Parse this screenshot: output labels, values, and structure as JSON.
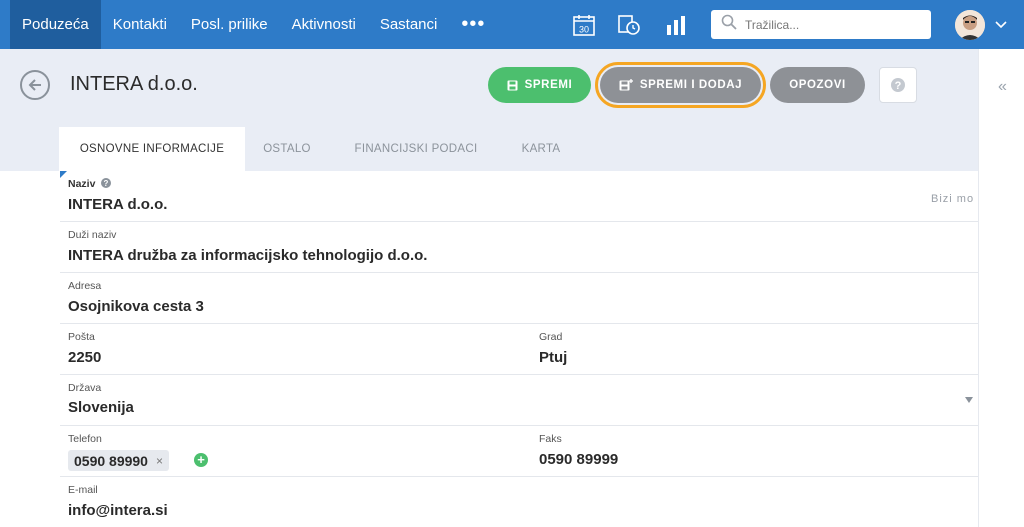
{
  "nav": {
    "items": [
      {
        "label": "Poduzeća",
        "active": true
      },
      {
        "label": "Kontakti",
        "active": false
      },
      {
        "label": "Posl. prilike",
        "active": false
      },
      {
        "label": "Aktivnosti",
        "active": false
      },
      {
        "label": "Sastanci",
        "active": false
      }
    ],
    "more_label": "•••",
    "calendar_day": "30",
    "search_placeholder": "Tražilica..."
  },
  "header": {
    "title": "INTERA d.o.o.",
    "save_label": "SPREMI",
    "save_add_label": "SPREMI I DODAJ",
    "cancel_label": "OPOZOVI",
    "help_label": "?"
  },
  "tabs": [
    {
      "label": "OSNOVNE INFORMACIJE",
      "active": true
    },
    {
      "label": "OSTALO",
      "active": false
    },
    {
      "label": "FINANCIJSKI PODACI",
      "active": false
    },
    {
      "label": "KARTA",
      "active": false
    }
  ],
  "form": {
    "naziv_label": "Naziv",
    "naziv_value": "INTERA d.o.o.",
    "bizi_label": "Bizi mo",
    "duzi_naziv_label": "Duži naziv",
    "duzi_naziv_value": "INTERA družba za informacijsko tehnologijo d.o.o.",
    "adresa_label": "Adresa",
    "adresa_value": "Osojnikova cesta 3",
    "posta_label": "Pošta",
    "posta_value": "2250",
    "grad_label": "Grad",
    "grad_value": "Ptuj",
    "drzava_label": "Država",
    "drzava_value": "Slovenija",
    "telefon_label": "Telefon",
    "telefon_value": "0590 89990",
    "telefon_remove": "×",
    "telefon_add": "+",
    "faks_label": "Faks",
    "faks_value": "0590 89999",
    "email_label": "E-mail",
    "email_value": "info@intera.si"
  },
  "colors": {
    "nav_bg": "#2e7bc8",
    "save_green": "#4cbf6e",
    "highlight_orange": "#f5a623",
    "grey_button": "#8e9196"
  }
}
